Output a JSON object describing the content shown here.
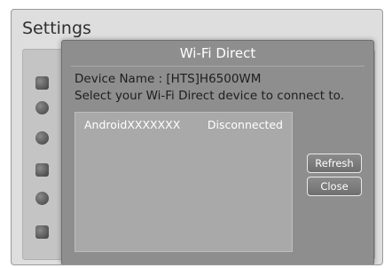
{
  "screen": {
    "title": "Settings"
  },
  "dialog": {
    "title": "Wi-Fi Direct",
    "device_name": "Device Name : [HTS]H6500WM",
    "instruction": "Select your Wi-Fi Direct device to connect to.",
    "devices": [
      {
        "name": "AndroidXXXXXXX",
        "status": "Disconnected"
      }
    ],
    "buttons": {
      "refresh": "Refresh",
      "close": "Close"
    }
  },
  "sidebar_icons": [
    "picture-icon",
    "sound-icon",
    "network-icon",
    "smart-hub-icon",
    "gear-icon",
    "support-icon"
  ]
}
